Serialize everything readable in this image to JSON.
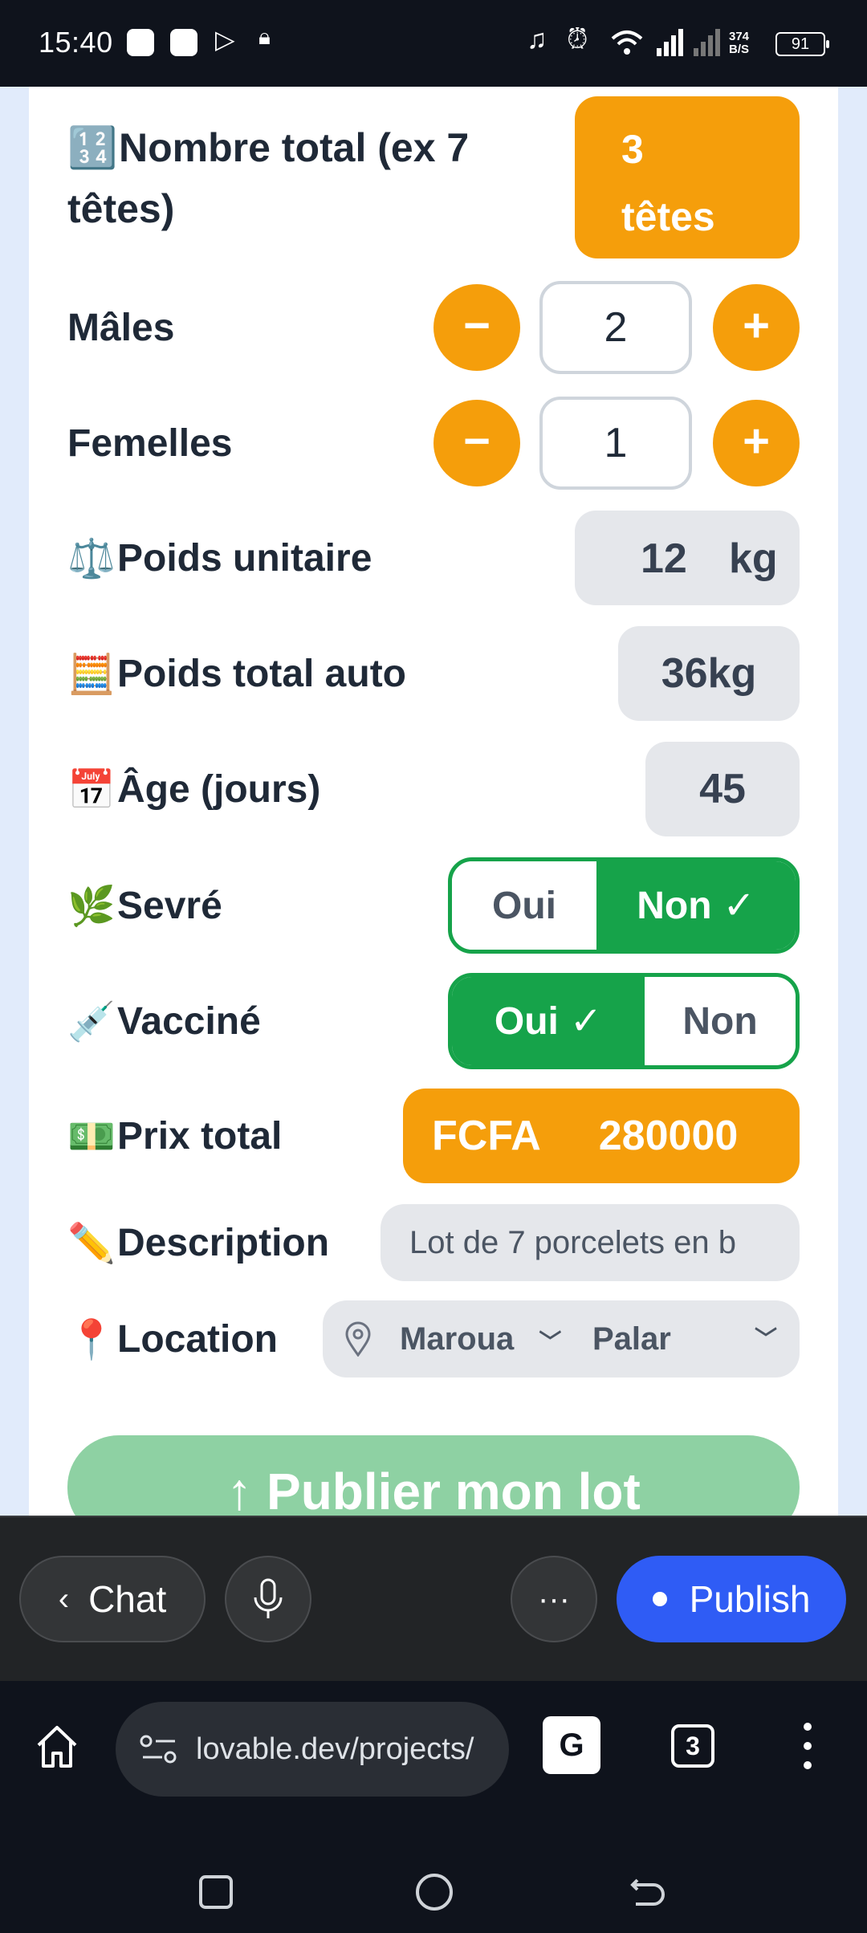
{
  "status_bar": {
    "time": "15:40",
    "net_speed": "374",
    "net_unit": "B/S",
    "battery": "91"
  },
  "form": {
    "total": {
      "emoji": "🔢",
      "label_line1": "Nombre total (ex 7",
      "label_line2": "têtes)",
      "count": "3",
      "unit": "têtes"
    },
    "males": {
      "label": "Mâles",
      "minus": "−",
      "plus": "+",
      "value": "2"
    },
    "femelles": {
      "label": "Femelles",
      "minus": "−",
      "plus": "+",
      "value": "1"
    },
    "poids_unitaire": {
      "emoji": "⚖️",
      "label": "Poids unitaire",
      "value": "12",
      "unit": "kg"
    },
    "poids_total": {
      "emoji": "🧮",
      "label": "Poids total auto",
      "value": "36kg"
    },
    "age": {
      "emoji": "📅",
      "label": "Âge (jours)",
      "value": "45"
    },
    "sevre": {
      "emoji": "🌿",
      "label": "Sevré",
      "oui": "Oui",
      "non": "Non",
      "check": "✓",
      "selected": "Non"
    },
    "vaccine": {
      "emoji": "💉",
      "label": "Vacciné",
      "oui": "Oui",
      "non": "Non",
      "check": "✓",
      "selected": "Oui"
    },
    "prix": {
      "emoji": "💵",
      "label": "Prix total",
      "currency": "FCFA",
      "value": "280000"
    },
    "description": {
      "emoji": "✏️",
      "label": "Description",
      "value": "Lot de 7 porcelets en b"
    },
    "location": {
      "emoji": "📍",
      "label": "Location",
      "city": "Maroua",
      "area": "Palar"
    },
    "publish_label": "↑ Publier mon lot"
  },
  "toolbar": {
    "chat_label": "Chat",
    "publish_label": "Publish"
  },
  "browser": {
    "url": "lovable.dev/projects/",
    "tabs_count": "3"
  },
  "colors": {
    "orange": "#f59e0b",
    "green": "#16a34a",
    "blue": "#2f5cf5"
  }
}
